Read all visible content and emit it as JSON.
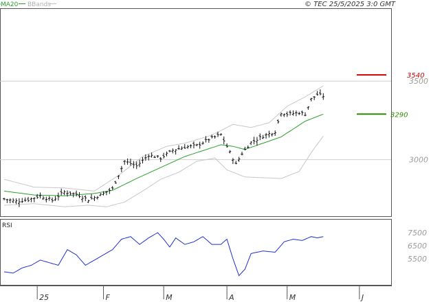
{
  "header": {
    "legend_ma": "MA20",
    "legend_bb": "BBands",
    "copyright": "© TEC 25/5/2025 3:0 GMT"
  },
  "colors": {
    "ma_line": "#2ca02c",
    "bands": "#c8c8c8",
    "price_bars": "#111111",
    "resistance": "#cc0000",
    "support": "#2e8b00",
    "rsi_line": "#1f2fd0",
    "grid": "#cfcfcf",
    "axis": "#555555"
  },
  "chart_data": [
    {
      "type": "line",
      "name": "price-panel",
      "y_ticks": [
        {
          "value": 3000,
          "label": "3000"
        },
        {
          "value": 3500,
          "label": "3500"
        }
      ],
      "ylim": [
        2640,
        3960
      ],
      "levels": [
        {
          "label": "3540",
          "value": 3540,
          "kind": "resistance"
        },
        {
          "label": "3290",
          "value": 3290,
          "kind": "support"
        }
      ],
      "x_labels": [
        {
          "label": "25",
          "index": 11
        },
        {
          "label": "F",
          "index": 33
        },
        {
          "label": "M",
          "index": 53
        },
        {
          "label": "A",
          "index": 74
        },
        {
          "label": "M",
          "index": 94
        },
        {
          "label": "J",
          "index": 118
        }
      ],
      "n_sessions": 120,
      "ohlc_close_keypoints": [
        [
          0,
          2750
        ],
        [
          4,
          2735
        ],
        [
          8,
          2745
        ],
        [
          12,
          2770
        ],
        [
          16,
          2740
        ],
        [
          20,
          2795
        ],
        [
          24,
          2780
        ],
        [
          28,
          2745
        ],
        [
          32,
          2775
        ],
        [
          36,
          2815
        ],
        [
          40,
          2990
        ],
        [
          44,
          2960
        ],
        [
          48,
          3030
        ],
        [
          52,
          3010
        ],
        [
          56,
          3060
        ],
        [
          60,
          3080
        ],
        [
          64,
          3090
        ],
        [
          68,
          3130
        ],
        [
          72,
          3160
        ],
        [
          75,
          3045
        ],
        [
          77,
          2970
        ],
        [
          79,
          3040
        ],
        [
          82,
          3110
        ],
        [
          86,
          3150
        ],
        [
          90,
          3180
        ],
        [
          92,
          3300
        ],
        [
          94,
          3290
        ],
        [
          98,
          3300
        ],
        [
          100,
          3290
        ],
        [
          102,
          3385
        ],
        [
          104,
          3415
        ],
        [
          106,
          3405
        ]
      ],
      "ma20_keypoints": [
        [
          0,
          2800
        ],
        [
          10,
          2775
        ],
        [
          20,
          2770
        ],
        [
          30,
          2785
        ],
        [
          36,
          2805
        ],
        [
          44,
          2880
        ],
        [
          52,
          2950
        ],
        [
          60,
          3020
        ],
        [
          68,
          3070
        ],
        [
          72,
          3095
        ],
        [
          76,
          3085
        ],
        [
          80,
          3065
        ],
        [
          86,
          3105
        ],
        [
          92,
          3145
        ],
        [
          96,
          3195
        ],
        [
          100,
          3245
        ],
        [
          106,
          3290
        ]
      ],
      "upper_band_keypoints": [
        [
          0,
          2875
        ],
        [
          10,
          2825
        ],
        [
          20,
          2820
        ],
        [
          30,
          2800
        ],
        [
          38,
          2900
        ],
        [
          46,
          3020
        ],
        [
          54,
          3085
        ],
        [
          60,
          3105
        ],
        [
          68,
          3150
        ],
        [
          72,
          3185
        ],
        [
          76,
          3225
        ],
        [
          82,
          3205
        ],
        [
          88,
          3235
        ],
        [
          94,
          3340
        ],
        [
          100,
          3400
        ],
        [
          106,
          3470
        ]
      ],
      "lower_band_keypoints": [
        [
          0,
          2710
        ],
        [
          10,
          2720
        ],
        [
          20,
          2700
        ],
        [
          28,
          2710
        ],
        [
          34,
          2700
        ],
        [
          40,
          2730
        ],
        [
          46,
          2800
        ],
        [
          52,
          2875
        ],
        [
          58,
          2920
        ],
        [
          64,
          2990
        ],
        [
          70,
          3010
        ],
        [
          74,
          2935
        ],
        [
          80,
          2890
        ],
        [
          86,
          2885
        ],
        [
          92,
          2880
        ],
        [
          98,
          2925
        ],
        [
          102,
          3045
        ],
        [
          106,
          3150
        ]
      ]
    },
    {
      "type": "line",
      "name": "rsi-panel",
      "title": "RSI",
      "y_ticks": [
        {
          "value": 75,
          "label": "7500"
        },
        {
          "value": 65,
          "label": "6500"
        },
        {
          "value": 55,
          "label": "5500"
        }
      ],
      "ylim": [
        35,
        85
      ],
      "rsi_keypoints": [
        [
          0,
          45
        ],
        [
          3,
          44
        ],
        [
          6,
          48
        ],
        [
          9,
          50
        ],
        [
          12,
          54
        ],
        [
          15,
          52
        ],
        [
          18,
          50
        ],
        [
          21,
          62
        ],
        [
          24,
          58
        ],
        [
          27,
          50
        ],
        [
          30,
          54
        ],
        [
          33,
          58
        ],
        [
          36,
          62
        ],
        [
          39,
          70
        ],
        [
          42,
          72
        ],
        [
          45,
          66
        ],
        [
          48,
          71
        ],
        [
          51,
          75
        ],
        [
          53,
          70
        ],
        [
          55,
          64
        ],
        [
          57,
          71
        ],
        [
          60,
          66
        ],
        [
          63,
          68
        ],
        [
          66,
          72
        ],
        [
          69,
          66
        ],
        [
          72,
          66
        ],
        [
          74,
          70
        ],
        [
          76,
          55
        ],
        [
          78,
          42
        ],
        [
          80,
          47
        ],
        [
          82,
          59
        ],
        [
          86,
          61
        ],
        [
          90,
          60
        ],
        [
          93,
          68
        ],
        [
          96,
          70
        ],
        [
          99,
          69
        ],
        [
          102,
          72
        ],
        [
          104,
          71
        ],
        [
          106,
          72
        ]
      ]
    }
  ]
}
